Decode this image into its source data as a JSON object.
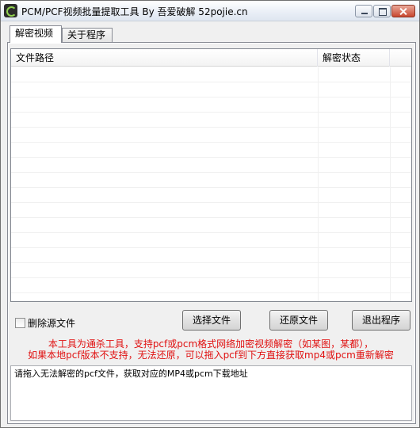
{
  "window": {
    "title": "PCM/PCF视频批量提取工具 By 吾爱破解 52pojie.cn"
  },
  "tabs": [
    {
      "label": "解密视频",
      "active": true
    },
    {
      "label": "关于程序",
      "active": false
    }
  ],
  "file_list": {
    "columns": [
      "文件路径",
      "解密状态",
      ""
    ],
    "rows": []
  },
  "options": {
    "delete_source_label": "删除源文件",
    "delete_source_checked": false
  },
  "buttons": {
    "select_files": "选择文件",
    "restore_files": "还原文件",
    "exit_program": "退出程序"
  },
  "notice": {
    "line1": "本工具为通杀工具，支持pcf或pcm格式网络加密视频解密（如某图，某都），",
    "line2": "如果本地pcf版本不支持，无法还原，可以拖入pcf到下方直接获取mp4或pcm重新解密",
    "color": "#e01010"
  },
  "input_area": {
    "value": "请拖入无法解密的pcf文件，获取对应的MP4或pcm下载地址"
  }
}
